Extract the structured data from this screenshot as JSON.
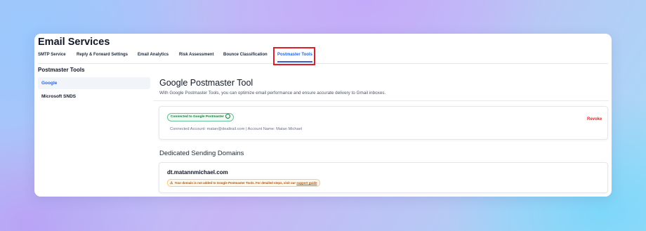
{
  "app": {
    "title": "Email Services"
  },
  "tabs": [
    {
      "label": "SMTP Service"
    },
    {
      "label": "Reply & Forward Settings"
    },
    {
      "label": "Email Analytics"
    },
    {
      "label": "Risk Assessment"
    },
    {
      "label": "Bounce Classification"
    },
    {
      "label": "Postmaster Tools",
      "active": true
    }
  ],
  "sidebar": {
    "title": "Postmaster Tools",
    "items": [
      {
        "label": "Google",
        "active": true
      },
      {
        "label": "Microsoft SNDS"
      }
    ]
  },
  "main": {
    "title": "Google Postmaster Tool",
    "description": "With Google Postmaster Tools, you can optimize email performance and ensure accurate delivery to Gmail inboxes."
  },
  "connection": {
    "status_label": "Connected to Google Postmaster",
    "status_icon": "check-circle-icon",
    "account_text": "Connected Account: matan@dealtrail.com | Account Name: Matan Michael",
    "revoke_label": "Revoke"
  },
  "domains": {
    "title": "Dedicated Sending Domains",
    "items": [
      {
        "name": "dt.matannmichael.com",
        "warning_icon": "warning-triangle-icon",
        "warning_text": "Your domain is not added to Google Postmaster Tools. For detailed steps, visit our",
        "warning_link": "support guide"
      }
    ]
  },
  "colors": {
    "accent": "#2563eb",
    "highlight_box": "#e11d2a",
    "success": "#15803d",
    "danger": "#dc2626",
    "warning": "#b45309"
  }
}
